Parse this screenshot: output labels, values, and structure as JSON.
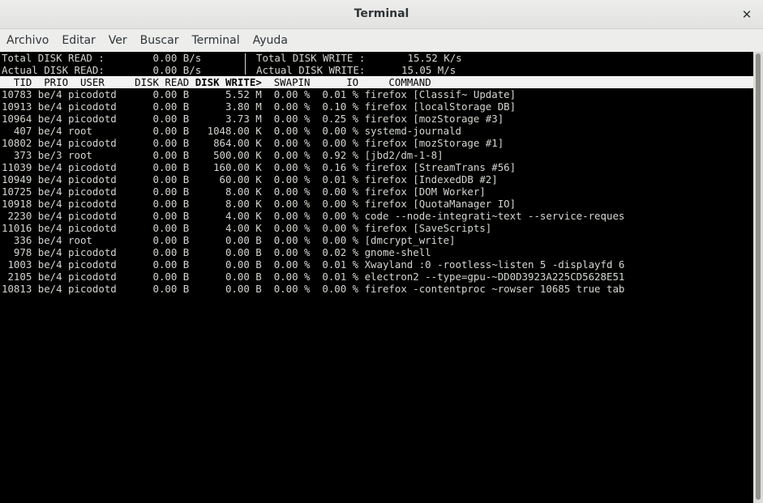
{
  "window": {
    "title": "Terminal",
    "close_glyph": "✕"
  },
  "menu": [
    "Archivo",
    "Editar",
    "Ver",
    "Buscar",
    "Terminal",
    "Ayuda"
  ],
  "summary": {
    "read_total": "Total DISK READ :        0.00 B/s",
    "read_actual": "Actual DISK READ:        0.00 B/s",
    "write_total": "Total DISK WRITE :       15.52 K/s",
    "write_actual": "Actual DISK WRITE:      15.05 M/s"
  },
  "columns": {
    "pre": "  TID  PRIO  USER     DISK READ ",
    "sorted": "DISK WRITE>",
    "post": "  SWAPIN      IO     COMMAND"
  },
  "rows": [
    "10783 be/4 picodotd      0.00 B      5.52 M  0.00 %  0.01 % firefox [Classif~ Update]",
    "10913 be/4 picodotd      0.00 B      3.80 M  0.00 %  0.10 % firefox [localStorage DB]",
    "10964 be/4 picodotd      0.00 B      3.73 M  0.00 %  0.25 % firefox [mozStorage #3]",
    "  407 be/4 root          0.00 B   1048.00 K  0.00 %  0.00 % systemd-journald",
    "10802 be/4 picodotd      0.00 B    864.00 K  0.00 %  0.00 % firefox [mozStorage #1]",
    "  373 be/3 root          0.00 B    500.00 K  0.00 %  0.92 % [jbd2/dm-1-8]",
    "11039 be/4 picodotd      0.00 B    160.00 K  0.00 %  0.16 % firefox [StreamTrans #56]",
    "10949 be/4 picodotd      0.00 B     60.00 K  0.00 %  0.01 % firefox [IndexedDB #2]",
    "10725 be/4 picodotd      0.00 B      8.00 K  0.00 %  0.00 % firefox [DOM Worker]",
    "10918 be/4 picodotd      0.00 B      8.00 K  0.00 %  0.00 % firefox [QuotaManager IO]",
    " 2230 be/4 picodotd      0.00 B      4.00 K  0.00 %  0.00 % code --node-integrati~text --service-reques",
    "11016 be/4 picodotd      0.00 B      4.00 K  0.00 %  0.00 % firefox [SaveScripts]",
    "  336 be/4 root          0.00 B      0.00 B  0.00 %  0.00 % [dmcrypt_write]",
    "  978 be/4 picodotd      0.00 B      0.00 B  0.00 %  0.02 % gnome-shell",
    " 1003 be/4 picodotd      0.00 B      0.00 B  0.00 %  0.01 % Xwayland :0 -rootless~listen 5 -displayfd 6",
    " 2105 be/4 picodotd      0.00 B      0.00 B  0.00 %  0.01 % electron2 --type=gpu-~DD0D3923A225CD5628E51",
    "10813 be/4 picodotd      0.00 B      0.00 B  0.00 %  0.00 % firefox -contentproc ~rowser 10685 true tab"
  ]
}
